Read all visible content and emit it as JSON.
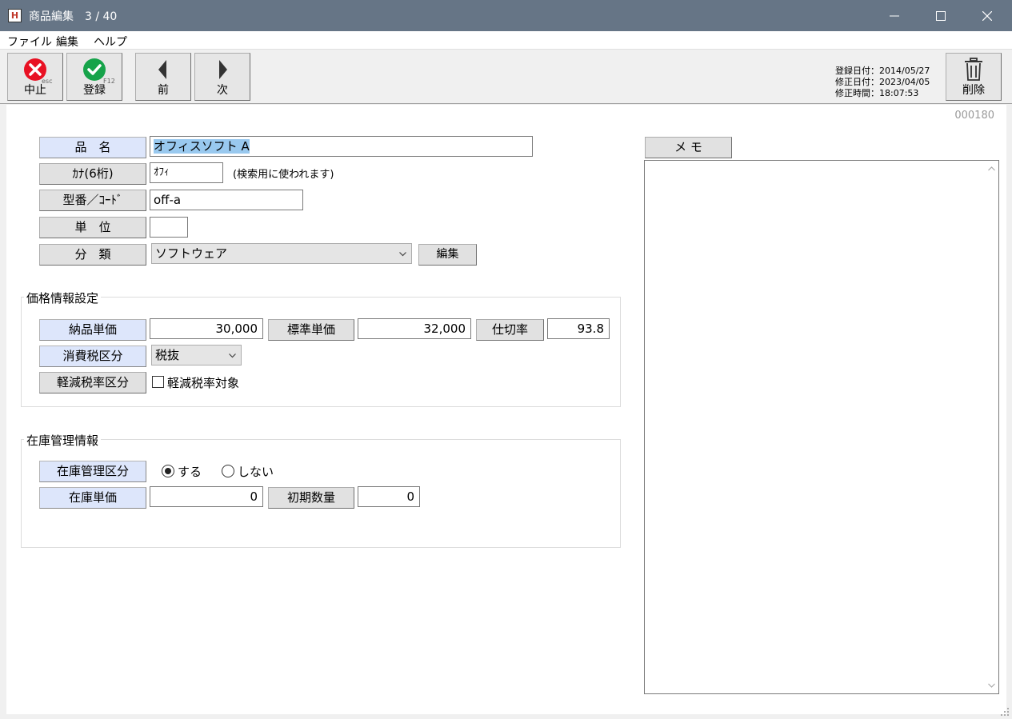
{
  "window": {
    "title": "商品編集",
    "record_position": "3 / 40",
    "app_icon_letter": "H"
  },
  "menu": [
    "ファイル",
    "編集",
    "ヘルプ"
  ],
  "toolbar": {
    "cancel_label": "中止",
    "cancel_hint": "esc",
    "register_label": "登録",
    "register_hint": "F12",
    "prev_label": "前",
    "next_label": "次",
    "delete_label": "削除",
    "registered_date": "登録日付：2014/05/27",
    "modified_date": "修正日付：2023/04/05",
    "modified_time": "修正時間：18:07:53"
  },
  "record_no": "000180",
  "form": {
    "name_label": "品　名",
    "name_value": "オフィスソフト A",
    "kana_label": "ｶﾅ(6桁)",
    "kana_value": "ｵﾌｨ",
    "kana_note": "(検索用に使われます)",
    "code_label": "型番／ｺｰﾄﾞ",
    "code_value": "off-a",
    "unit_label": "単　位",
    "unit_value": "",
    "category_label": "分　類",
    "category_value": "ソフトウェア",
    "category_edit": "編集"
  },
  "price": {
    "group_title": "価格情報設定",
    "delivery_label": "納品単価",
    "delivery_value": "30,000",
    "standard_label": "標準単価",
    "standard_value": "32,000",
    "rate_label": "仕切率",
    "rate_value": "93.8",
    "tax_label": "消費税区分",
    "tax_value": "税抜",
    "reduced_label": "軽減税率区分",
    "reduced_check_label": "軽減税率対象",
    "reduced_checked": false
  },
  "stock": {
    "group_title": "在庫管理情報",
    "manage_label": "在庫管理区分",
    "opt_yes": "する",
    "opt_no": "しない",
    "selected": "yes",
    "unit_price_label": "在庫単価",
    "unit_price_value": "0",
    "initial_qty_label": "初期数量",
    "initial_qty_value": "0"
  },
  "memo": {
    "label": "メ モ",
    "value": ""
  },
  "colors": {
    "titlebar": "#667586",
    "label_blue": "#dde6fb",
    "selection": "#99c9ef",
    "cancel_red": "#e81123",
    "ok_green": "#16a34a"
  }
}
